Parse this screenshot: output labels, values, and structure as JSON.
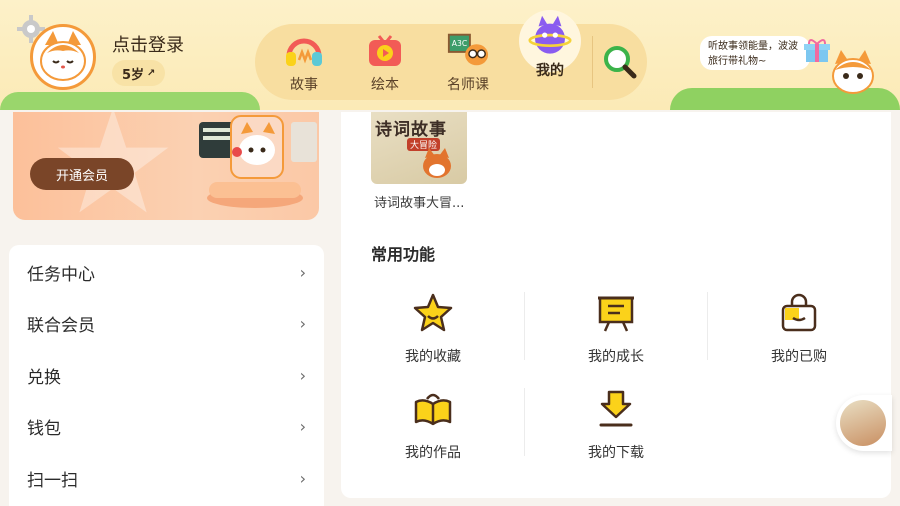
{
  "header": {
    "login_text": "点击登录",
    "age_label": "5岁",
    "nav": [
      {
        "label": "故事",
        "icon": "headphones-icon"
      },
      {
        "label": "绘本",
        "icon": "picture-book-play-icon"
      },
      {
        "label": "名师课",
        "icon": "teacher-class-icon"
      },
      {
        "label": "我的",
        "icon": "planet-cat-icon",
        "active": true
      }
    ],
    "search_icon": "search-icon",
    "promo_text": "听故事领能量，波波旅行带礼物~"
  },
  "vip": {
    "button_label": "开通会员"
  },
  "menu": [
    {
      "label": "任务中心"
    },
    {
      "label": "联合会员"
    },
    {
      "label": "兑换"
    },
    {
      "label": "钱包"
    },
    {
      "label": "扫一扫"
    }
  ],
  "recent": {
    "book_cover_title": "诗词故事",
    "book_cover_sub": "大冒险",
    "book_title": "诗词故事大冒..."
  },
  "functions": {
    "title": "常用功能",
    "items": [
      {
        "label": "我的收藏",
        "icon": "star-icon"
      },
      {
        "label": "我的成长",
        "icon": "growth-board-icon"
      },
      {
        "label": "我的已购",
        "icon": "shopping-bag-icon"
      },
      {
        "label": "我的作品",
        "icon": "open-book-icon"
      },
      {
        "label": "我的下载",
        "icon": "download-icon"
      }
    ]
  },
  "colors": {
    "accent_yellow": "#fbd21a",
    "brown": "#4a2e1c",
    "orange": "#f49a3a"
  }
}
